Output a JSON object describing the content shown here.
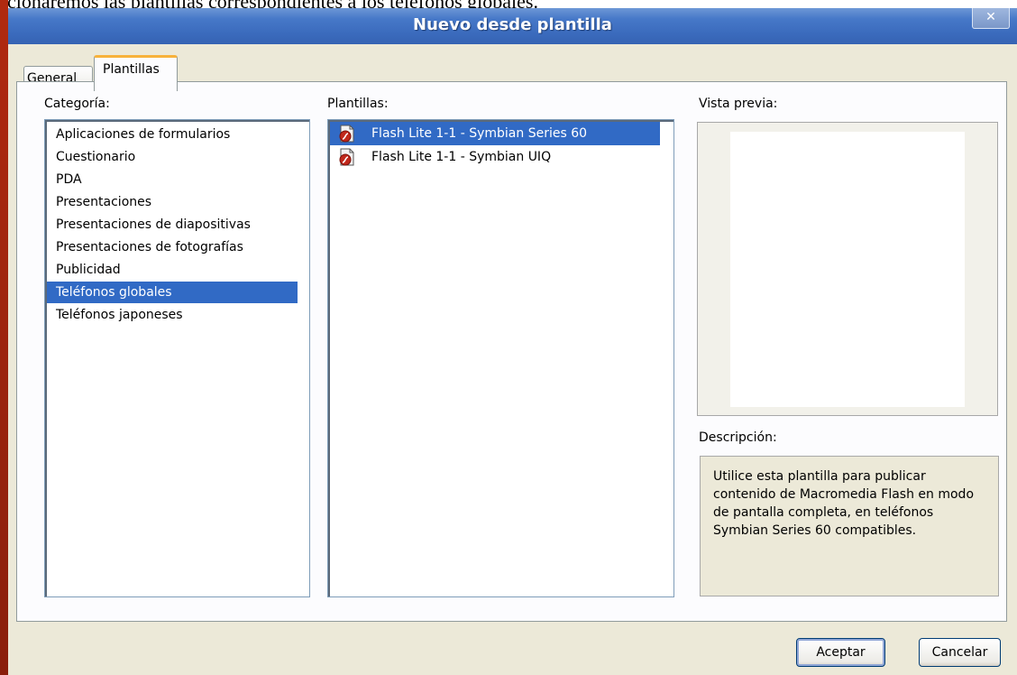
{
  "document": {
    "text_above": "cionaremos las plantillas correspondientes a los teléfonos globales."
  },
  "window": {
    "title": "Nuevo desde plantilla",
    "close_label": "✕"
  },
  "tabs": [
    {
      "label": "General",
      "selected": false
    },
    {
      "label": "Plantillas",
      "selected": true
    }
  ],
  "categoria": {
    "label": "Categoría:",
    "items": [
      "Aplicaciones de formularios",
      "Cuestionario",
      "PDA",
      "Presentaciones",
      "Presentaciones de diapositivas",
      "Presentaciones de fotografías",
      "Publicidad",
      "Teléfonos globales",
      "Teléfonos japoneses"
    ],
    "selected": "Teléfonos globales"
  },
  "plantillas": {
    "label": "Plantillas:",
    "items": [
      {
        "label": "Flash Lite 1-1 - Symbian Series 60",
        "icon": "flash-document-icon"
      },
      {
        "label": "Flash Lite 1-1 - Symbian UIQ",
        "icon": "flash-document-icon"
      }
    ],
    "selected": "Flash Lite 1-1 - Symbian Series 60"
  },
  "preview": {
    "label": "Vista previa:"
  },
  "description": {
    "label": "Descripción:",
    "text": "Utilice esta plantilla para publicar contenido de Macromedia Flash en modo de pantalla completa, en teléfonos Symbian Series 60 compatibles."
  },
  "buttons": {
    "ok": "Aceptar",
    "cancel": "Cancelar"
  },
  "colors": {
    "selection": "#316ac5",
    "titlebar": "#3b6bbd",
    "dialog_bg": "#ece9d8",
    "active_tab_accent": "#f7b23b"
  }
}
